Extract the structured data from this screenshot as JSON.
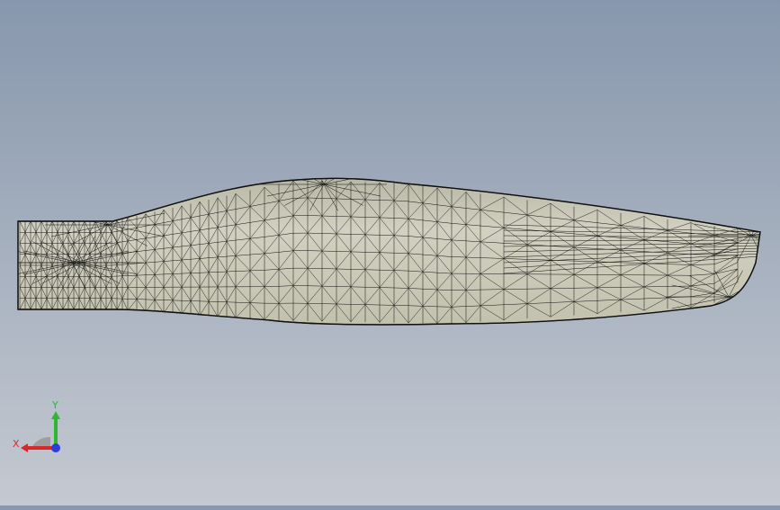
{
  "viewport": {
    "background_top": "#8797ad",
    "background_bottom": "#c4c9d1",
    "model_fill": "#c8c6b4",
    "mesh_line": "#111111"
  },
  "triad": {
    "x_label": "X",
    "y_label": "Y",
    "x_color": "#d42a2a",
    "y_color": "#2fb82f",
    "z_color": "#2a3fd9",
    "sphere_color": "#9a9a9a"
  }
}
